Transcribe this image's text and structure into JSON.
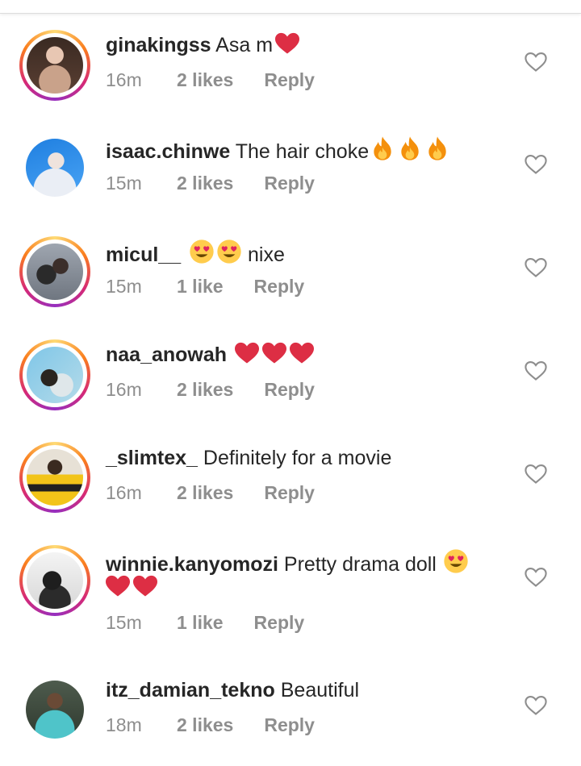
{
  "comments": [
    {
      "username": "ginakingss",
      "text": "Asa m",
      "emojis_after": [
        "red-heart"
      ],
      "time": "16m",
      "likes": "2 likes",
      "reply": "Reply",
      "ring": true,
      "colors": [
        "#3a2a22",
        "#c9a28a",
        "#e8c7b3"
      ]
    },
    {
      "username": "isaac.chinwe",
      "text": "The hair choke",
      "emojis_after": [
        "fire",
        "fire",
        "fire"
      ],
      "time": "15m",
      "likes": "2 likes",
      "reply": "Reply",
      "ring": false,
      "colors": [
        "#1f7fe0",
        "#eaeef5",
        "#c9b7d8"
      ]
    },
    {
      "username": "micul__",
      "text": "nixe",
      "emojis_before": [
        "heart-eyes",
        "heart-eyes"
      ],
      "time": "15m",
      "likes": "1 like",
      "reply": "Reply",
      "ring": true,
      "colors": [
        "#9fa6b0",
        "#3b2e2a",
        "#1b1b1b"
      ]
    },
    {
      "username": "naa_anowah",
      "text": "",
      "emojis_after": [
        "red-heart",
        "red-heart",
        "red-heart"
      ],
      "time": "16m",
      "likes": "2 likes",
      "reply": "Reply",
      "ring": true,
      "colors": [
        "#7fc6e8",
        "#dfe7ea",
        "#2a2520"
      ]
    },
    {
      "username": "_slimtex_",
      "text": "Definitely for a movie",
      "time": "16m",
      "likes": "2 likes",
      "reply": "Reply",
      "ring": true,
      "colors": [
        "#e7e1d6",
        "#f2c419",
        "#202020"
      ]
    },
    {
      "username": "winnie.kanyomozi",
      "text": "Pretty drama doll",
      "emojis_after": [
        "heart-eyes"
      ],
      "second_line_emojis": [
        "red-heart",
        "red-heart"
      ],
      "time": "15m",
      "likes": "1 like",
      "reply": "Reply",
      "ring": true,
      "colors": [
        "#d8d8d8",
        "#f4f4f4",
        "#1e1e1e"
      ]
    },
    {
      "username": "itz_damian_tekno",
      "text": "Beautiful",
      "time": "18m",
      "likes": "2 likes",
      "reply": "Reply",
      "ring": false,
      "colors": [
        "#4e5b4d",
        "#4fc4c9",
        "#6a4a36"
      ]
    }
  ],
  "icons": {
    "like": "heart-outline-icon"
  }
}
